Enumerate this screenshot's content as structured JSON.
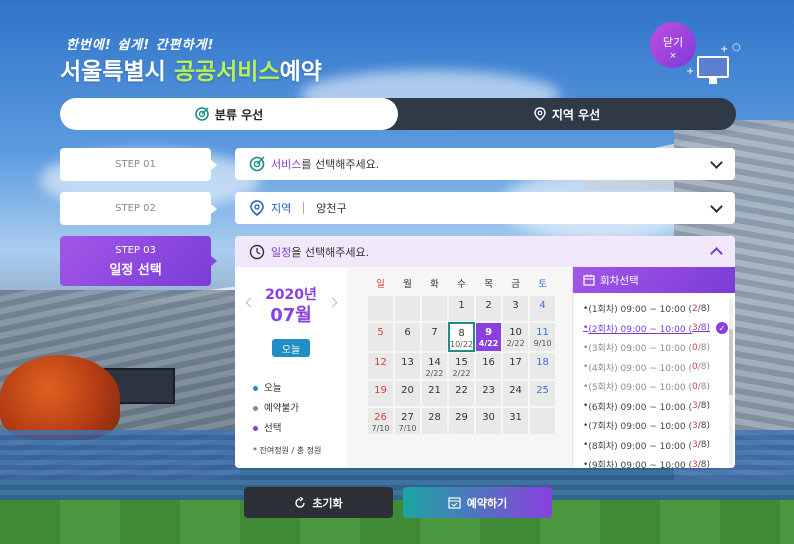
{
  "header": {
    "slogan": "한번에! 쉽게! 간편하게!",
    "brand_main": "서울특별시 ",
    "brand_highlight": "공공서비스",
    "brand_tail": "예약",
    "close_label": "닫기",
    "close_icon": "×"
  },
  "tabs": [
    {
      "label": "분류 우선",
      "icon": "target-icon",
      "active": true
    },
    {
      "label": "지역 우선",
      "icon": "location-pin-icon",
      "active": false
    }
  ],
  "steps": [
    {
      "label": "STEP 01"
    },
    {
      "label": "STEP 02"
    },
    {
      "label": "STEP 03",
      "title": "일정 선택"
    }
  ],
  "service_select": {
    "accent": "서비스",
    "text": "를 선택해주세요."
  },
  "region_select": {
    "label": "지역",
    "value": "양천구"
  },
  "schedule": {
    "accent": "일정",
    "text": "을 선택해주세요.",
    "year": "2020년",
    "month": "07월",
    "today_button": "오늘",
    "legend": [
      {
        "label": "오늘",
        "color": "#1f8fc4"
      },
      {
        "label": "예약불가",
        "color": "#888888"
      },
      {
        "label": "선택",
        "color": "#8a3fe0"
      }
    ],
    "legend_note": "* 잔여정원 / 총 정원"
  },
  "calendar": {
    "weekdays": [
      "일",
      "월",
      "화",
      "수",
      "목",
      "금",
      "토"
    ],
    "weeks": [
      [
        {
          "d": ""
        },
        {
          "d": ""
        },
        {
          "d": ""
        },
        {
          "d": "1"
        },
        {
          "d": "2"
        },
        {
          "d": "3"
        },
        {
          "d": "4"
        }
      ],
      [
        {
          "d": "5"
        },
        {
          "d": "6"
        },
        {
          "d": "7"
        },
        {
          "d": "8",
          "sub": "10/22",
          "state": "today"
        },
        {
          "d": "9",
          "sub": "4/22",
          "state": "selected"
        },
        {
          "d": "10",
          "sub": "2/22"
        },
        {
          "d": "11",
          "sub": "9/10"
        }
      ],
      [
        {
          "d": "12"
        },
        {
          "d": "13"
        },
        {
          "d": "14",
          "sub": "2/22"
        },
        {
          "d": "15",
          "sub": "2/22"
        },
        {
          "d": "16"
        },
        {
          "d": "17"
        },
        {
          "d": "18"
        }
      ],
      [
        {
          "d": "19"
        },
        {
          "d": "20"
        },
        {
          "d": "21"
        },
        {
          "d": "22"
        },
        {
          "d": "23"
        },
        {
          "d": "24"
        },
        {
          "d": "25"
        }
      ],
      [
        {
          "d": "26",
          "sub": "7/10"
        },
        {
          "d": "27",
          "sub": "7/10"
        },
        {
          "d": "28"
        },
        {
          "d": "29"
        },
        {
          "d": "30"
        },
        {
          "d": "31"
        },
        {
          "d": ""
        }
      ]
    ]
  },
  "sessions": {
    "title": "회차선택",
    "items": [
      {
        "label": "(1회차) 09:00 ~ 10:00 (",
        "count": "2",
        "total": "/8)",
        "state": "normal"
      },
      {
        "label": "(2회차) 09:00 ~ 10:00 (",
        "count": "3",
        "total": "/8)",
        "state": "picked"
      },
      {
        "label": "(3회차) 09:00 ~ 10:00 (",
        "count": "0",
        "total": "/8)",
        "state": "dim"
      },
      {
        "label": "(4회차) 09:00 ~ 10:00 (",
        "count": "0",
        "total": "/8)",
        "state": "dim"
      },
      {
        "label": "(5회차) 09:00 ~ 10:00 (",
        "count": "0",
        "total": "/8)",
        "state": "dim"
      },
      {
        "label": "(6회차) 09:00 ~ 10:00 (",
        "count": "3",
        "total": "/8)",
        "state": "normal"
      },
      {
        "label": "(7회차) 09:00 ~ 10:00 (",
        "count": "3",
        "total": "/8)",
        "state": "normal"
      },
      {
        "label": "(8회차) 09:00 ~ 10:00 (",
        "count": "3",
        "total": "/8)",
        "state": "normal"
      },
      {
        "label": "(9회차) 09:00 ~ 10:00 (",
        "count": "3",
        "total": "/8)",
        "state": "normal"
      }
    ]
  },
  "actions": {
    "reset": "초기화",
    "book": "예약하기"
  }
}
